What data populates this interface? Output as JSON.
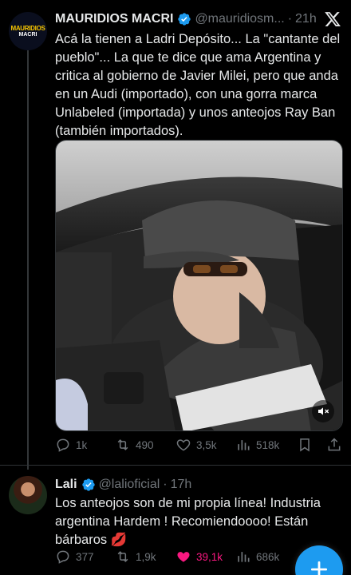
{
  "tweet1": {
    "avatar_text_line1": "MAURIDIOS",
    "avatar_text_line2": "MACRI",
    "name": "MAURIDIOS MACRI",
    "handle": "@mauridiosm...",
    "separator": "·",
    "time": "21h",
    "text": "Acá la tienen a Ladri Depósito... La \"cantante del pueblo\"... La que te dice que ama Argentina y critica al gobierno de Javier Milei, pero que anda en un Audi (importado), con una gorra marca Unlabeled (importada) y unos anteojos Ray Ban (también importados).",
    "media_icon": "mute-icon",
    "stats": {
      "replies": "1k",
      "reposts": "490",
      "likes": "3,5k",
      "views": "518k"
    }
  },
  "tweet2": {
    "name": "Lali",
    "handle": "@lalioficial",
    "separator": "·",
    "time": "17h",
    "text": "Los anteojos son de mi propia línea! Industria argentina Hardem ! Recomiendoooo! Están bárbaros 💋",
    "stats": {
      "replies": "377",
      "reposts": "1,9k",
      "likes": "39,1k",
      "views": "686k"
    },
    "likes_active": true
  },
  "colors": {
    "verified": "#1d9bf0",
    "like_active": "#f91880",
    "fab": "#1d9bf0",
    "muted_text": "#71767b"
  },
  "fab_icon": "plus-icon"
}
